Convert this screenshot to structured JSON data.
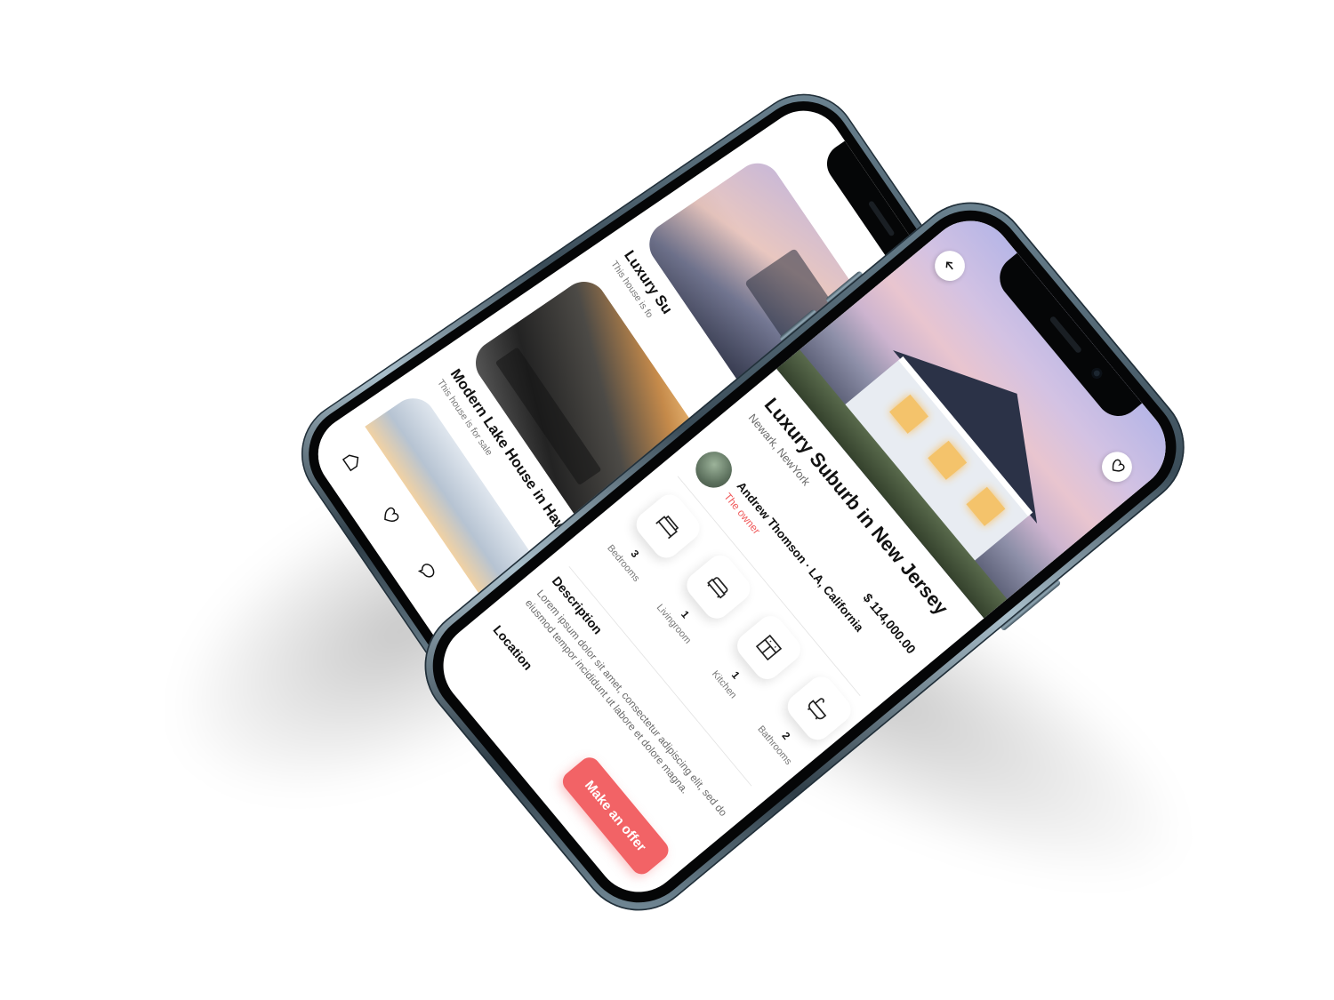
{
  "colors": {
    "accent": "#f26366",
    "frame": "#5b7180",
    "text": "#111111",
    "muted": "#777777"
  },
  "list_screen": {
    "menu_icon": "hamburger-icon",
    "cards": [
      {
        "title": "Luxury Su",
        "subtitle": "This house is fo"
      },
      {
        "title": "Modern Lake House in Hawaii",
        "subtitle": "This house is for sale"
      }
    ],
    "tabs": [
      {
        "icon": "home-icon"
      },
      {
        "icon": "heart-icon"
      },
      {
        "icon": "chat-icon"
      },
      {
        "icon": "profile-icon"
      }
    ]
  },
  "detail_screen": {
    "back_icon": "arrow-left-icon",
    "favorite_icon": "heart-icon",
    "title": "Luxury Suburb in New Jersey",
    "location": "Newark, NewYork",
    "price": "$ 114,000.00",
    "owner": {
      "name": "Andrew Thomson · LA, California",
      "role": "The owner"
    },
    "features": [
      {
        "icon": "bed-icon",
        "count": "3",
        "label": "Bedrooms"
      },
      {
        "icon": "sofa-icon",
        "count": "1",
        "label": "Livingroom"
      },
      {
        "icon": "kitchen-icon",
        "count": "1",
        "label": "Kitchen"
      },
      {
        "icon": "bathtub-icon",
        "count": "2",
        "label": "Bathrooms"
      }
    ],
    "description_title": "Description",
    "description": "Lorem ipsum dolor sit amet, consectetur adipiscing elit, sed do eiusmod tempor incididunt ut labore et dolore magna.",
    "location_title": "Location",
    "cta_label": "Make an offer"
  }
}
